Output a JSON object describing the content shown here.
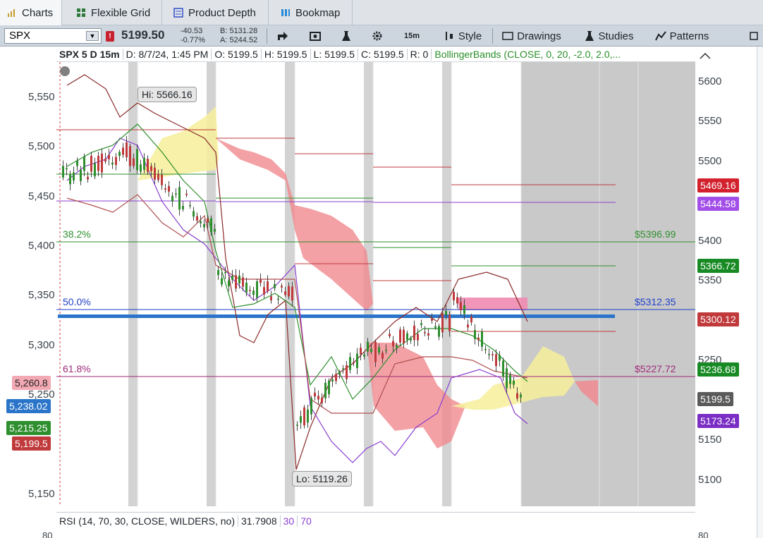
{
  "tabs": [
    {
      "label": "Charts",
      "icon": "bar-chart-icon",
      "active": true
    },
    {
      "label": "Flexible Grid",
      "icon": "grid-icon",
      "active": false
    },
    {
      "label": "Product Depth",
      "icon": "depth-icon",
      "active": false
    },
    {
      "label": "Bookmap",
      "icon": "bookmap-icon",
      "active": false
    }
  ],
  "toolbar": {
    "symbol": "SPX",
    "alert_badge": "!",
    "last_price": "5199.50",
    "net_change": "-40.53",
    "pct_change": "-0.77%",
    "bid": "B: 5131.28",
    "ask": "A: 5244.52",
    "timeframe": "15m",
    "style_label": "Style",
    "drawings_label": "Drawings",
    "studies_label": "Studies",
    "patterns_label": "Patterns"
  },
  "info_bar": {
    "title": "SPX 5 D 15m",
    "date": "D: 8/7/24, 1:45 PM",
    "open": "O: 5199.5",
    "high": "H: 5199.5",
    "low": "L: 5199.5",
    "close": "C: 5199.5",
    "range": "R: 0",
    "study": "BollingerBands (CLOSE, 0, 20, -2.0, 2.0,..."
  },
  "rsi_bar": {
    "label": "RSI (14, 70, 30, CLOSE, WILDERS, no)",
    "value": "31.7908",
    "oversold": "30",
    "overbought": "70"
  },
  "chart_annotations": {
    "hi_label": "Hi: 5566.16",
    "lo_label": "Lo: 5119.26",
    "fib_382": "38.2%",
    "fib_500": "50.0%",
    "fib_618": "61.8%",
    "fib_price_382": "$5396.99",
    "fib_price_500": "$5312.35",
    "fib_price_618": "$5227.72",
    "rsi_axis_left": "80",
    "rsi_axis_right": "80"
  },
  "left_axis": {
    "ticks": [
      "5,550",
      "5,500",
      "5,450",
      "5,400",
      "5,350",
      "5,300",
      "5,250",
      "5,150"
    ],
    "tags": [
      {
        "text": "5,260.8",
        "color": "#f3a9b4",
        "text_color": "#222222"
      },
      {
        "text": "5,238.02",
        "color": "#2a75c9",
        "text_color": "#ffffff"
      },
      {
        "text": "5,215.25",
        "color": "#2e8f2e",
        "text_color": "#ffffff"
      },
      {
        "text": "5,199.5",
        "color": "#c0393b",
        "text_color": "#ffffff"
      }
    ]
  },
  "right_axis": {
    "ticks": [
      "5600",
      "5550",
      "5500",
      "5400",
      "5350",
      "5250",
      "5150",
      "5100"
    ],
    "tags": [
      {
        "text": "5469.16",
        "color": "#d3202d",
        "text_color": "#ffffff"
      },
      {
        "text": "5444.58",
        "color": "#a24ee8",
        "text_color": "#ffffff"
      },
      {
        "text": "5366.72",
        "color": "#178a24",
        "text_color": "#ffffff"
      },
      {
        "text": "5300.12",
        "color": "#c0393b",
        "text_color": "#ffffff"
      },
      {
        "text": "5236.68",
        "color": "#178a24",
        "text_color": "#ffffff"
      },
      {
        "text": "5199.5",
        "color": "#5a5a5a",
        "text_color": "#ffffff"
      },
      {
        "text": "5173.24",
        "color": "#7a2ec4",
        "text_color": "#ffffff"
      }
    ]
  },
  "colors": {
    "bull_candle": "#2e8f2e",
    "bear_candle": "#c0393b",
    "cloud_bull": "#f7ef9a",
    "cloud_bear": "#f08a8f",
    "grid_session": "#d3d3d3",
    "fib_blue": "#1f3ec9"
  }
}
